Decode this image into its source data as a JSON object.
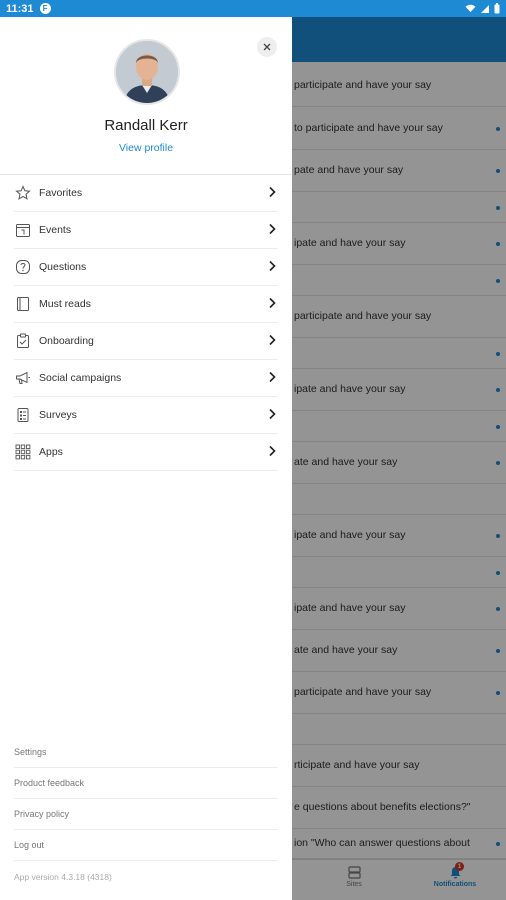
{
  "status_bar": {
    "time": "11:31",
    "app_letter": "F"
  },
  "profile": {
    "name": "Randall Kerr",
    "view_profile_label": "View profile"
  },
  "menu": [
    {
      "label": "Favorites",
      "icon": "star-icon"
    },
    {
      "label": "Events",
      "icon": "calendar-icon"
    },
    {
      "label": "Questions",
      "icon": "question-icon"
    },
    {
      "label": "Must reads",
      "icon": "book-icon"
    },
    {
      "label": "Onboarding",
      "icon": "clipboard-icon"
    },
    {
      "label": "Social campaigns",
      "icon": "megaphone-icon"
    },
    {
      "label": "Surveys",
      "icon": "survey-icon"
    },
    {
      "label": "Apps",
      "icon": "grid-icon"
    }
  ],
  "footer": {
    "settings": "Settings",
    "product_feedback": "Product feedback",
    "privacy_policy": "Privacy policy",
    "log_out": "Log out",
    "app_version": "App version 4.3.18 (4318)"
  },
  "background": {
    "rows": [
      "participate and have your say",
      "to participate and have your say",
      "pate and have your say",
      "",
      "ipate and have your say",
      "",
      "participate and have your say",
      "",
      "ipate and have your say",
      "",
      "ate and have your say",
      "",
      "ipate and have your say",
      "",
      "ipate and have your say",
      "ate and have your say",
      "participate and have your say",
      "",
      "rticipate and have your say",
      "e questions about benefits elections?\"",
      "ion \"Who can answer questions about"
    ],
    "tabs": {
      "sites": "Sites",
      "notifications": "Notifications",
      "badge": "1"
    },
    "accent_color": "#1d8ad3"
  }
}
